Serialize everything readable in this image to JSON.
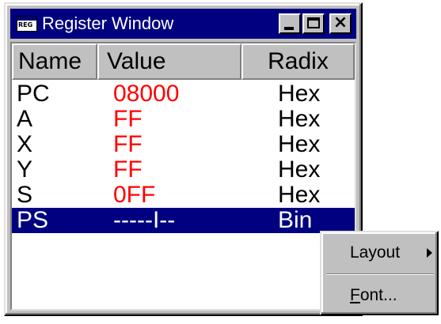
{
  "window": {
    "title": "Register Window",
    "icon_text": "REG",
    "icon": "reg-app-icon",
    "buttons": {
      "minimize_icon": "minimize-icon",
      "maximize_icon": "maximize-icon",
      "close_glyph": "×"
    }
  },
  "table": {
    "columns": [
      "Name",
      "Value",
      "Radix"
    ],
    "rows": [
      {
        "name": "PC",
        "value": "08000",
        "radix": "Hex"
      },
      {
        "name": "A",
        "value": "FF",
        "radix": "Hex"
      },
      {
        "name": "X",
        "value": "FF",
        "radix": "Hex"
      },
      {
        "name": "Y",
        "value": "FF",
        "radix": "Hex"
      },
      {
        "name": "S",
        "value": "0FF",
        "radix": "Hex"
      },
      {
        "name": "PS",
        "value": "-----I--",
        "radix": "Bin"
      }
    ],
    "selected_row": 5
  },
  "context_menu": {
    "items": [
      {
        "label": "Layout",
        "has_submenu": true
      },
      {
        "label_prefix": "F",
        "label_rest": "ont...",
        "has_submenu": false
      }
    ]
  },
  "colors": {
    "title_bar": "#000080",
    "selection": "#000080",
    "value_text": "#ff0000",
    "chrome": "#c0c0c0"
  }
}
